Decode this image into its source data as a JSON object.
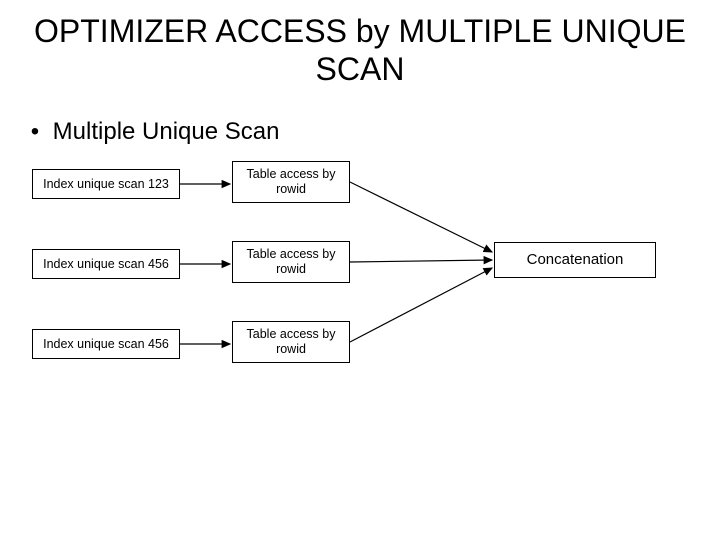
{
  "title": "OPTIMIZER ACCESS by MULTIPLE UNIQUE SCAN",
  "bullet": {
    "dot": "•",
    "text": "Multiple Unique Scan"
  },
  "diagram": {
    "scan1": "Index unique scan 123",
    "scan2": "Index unique scan 456",
    "scan3": "Index unique scan 456",
    "table1": "Table access by rowid",
    "table2": "Table access by rowid",
    "table3": "Table access by rowid",
    "concat": "Concatenation"
  }
}
